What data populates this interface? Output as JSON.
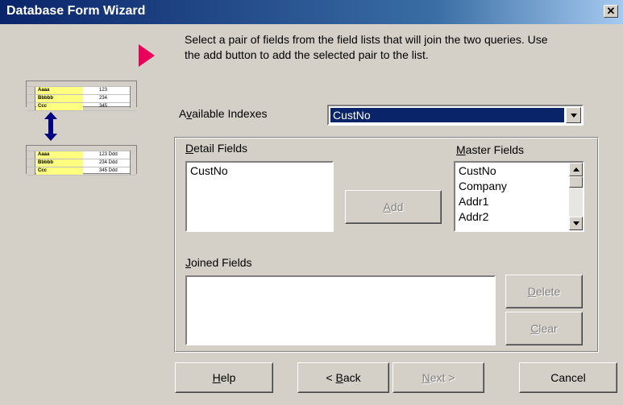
{
  "window": {
    "title": "Database Form Wizard",
    "close_glyph": "✕"
  },
  "instructions": "Select a pair of fields from the field lists that will join the two queries.  Use the add button to add the selected pair to the list.",
  "available_indexes": {
    "label_pre": "A",
    "label_accel": "v",
    "label_post": "ailable Indexes",
    "value": "CustNo"
  },
  "detail_fields": {
    "label_accel": "D",
    "label_post": "etail Fields",
    "items": [
      "CustNo"
    ]
  },
  "master_fields": {
    "label_accel": "M",
    "label_post": "aster Fields",
    "items": [
      "CustNo",
      "Company",
      "Addr1",
      "Addr2"
    ]
  },
  "joined_fields": {
    "label_accel": "J",
    "label_post": "oined Fields",
    "items": []
  },
  "buttons": {
    "add": {
      "accel": "A",
      "rest": "dd"
    },
    "delete": {
      "accel": "D",
      "rest": "elete"
    },
    "clear": {
      "accel": "C",
      "rest": "lear"
    },
    "help": {
      "accel": "H",
      "rest": "elp"
    },
    "back": {
      "pre": "< ",
      "accel": "B",
      "rest": "ack"
    },
    "next": {
      "accel": "N",
      "rest": "ext >"
    },
    "cancel": {
      "label": "Cancel"
    }
  },
  "illustration": {
    "rows_top": [
      {
        "text": "Aaaa",
        "num": "123"
      },
      {
        "text": "Bbbbb",
        "num": "234"
      },
      {
        "text": "Ccc",
        "num": "345"
      }
    ],
    "rows_bottom": [
      {
        "text": "Aaaa",
        "num": "123 Ddd"
      },
      {
        "text": "Bbbbb",
        "num": "234 Ddd"
      },
      {
        "text": "Ccc",
        "num": "345 Ddd"
      }
    ]
  },
  "colors": {
    "title_bar": "#0a246a",
    "pointer": "#e8005a",
    "highlight": "#0a246a",
    "arrow": "#000080",
    "illus_fill": "#ffff80"
  },
  "icons": {
    "close": "close-icon",
    "pointer": "pointer-arrow-icon",
    "link": "double-arrow-icon",
    "dropdown": "chevron-down-icon"
  }
}
